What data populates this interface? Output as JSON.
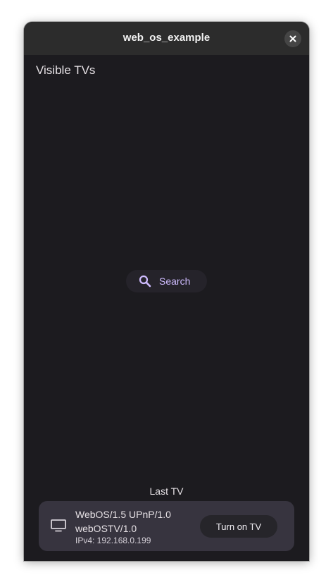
{
  "window": {
    "title": "web_os_example",
    "close_icon": "close-icon"
  },
  "main": {
    "section_title": "Visible TVs",
    "search": {
      "label": "Search",
      "icon": "search-icon"
    }
  },
  "last_tv": {
    "heading": "Last TV",
    "name": "WebOS/1.5 UPnP/1.0 webOSTV/1.0",
    "ip": "IPv4: 192.168.0.199",
    "icon": "tv-icon",
    "action_label": "Turn on TV"
  },
  "colors": {
    "background": "#1c1b1f",
    "titlebar": "#2c2c2c",
    "accent": "#cfbcff",
    "card": "#37343f"
  }
}
